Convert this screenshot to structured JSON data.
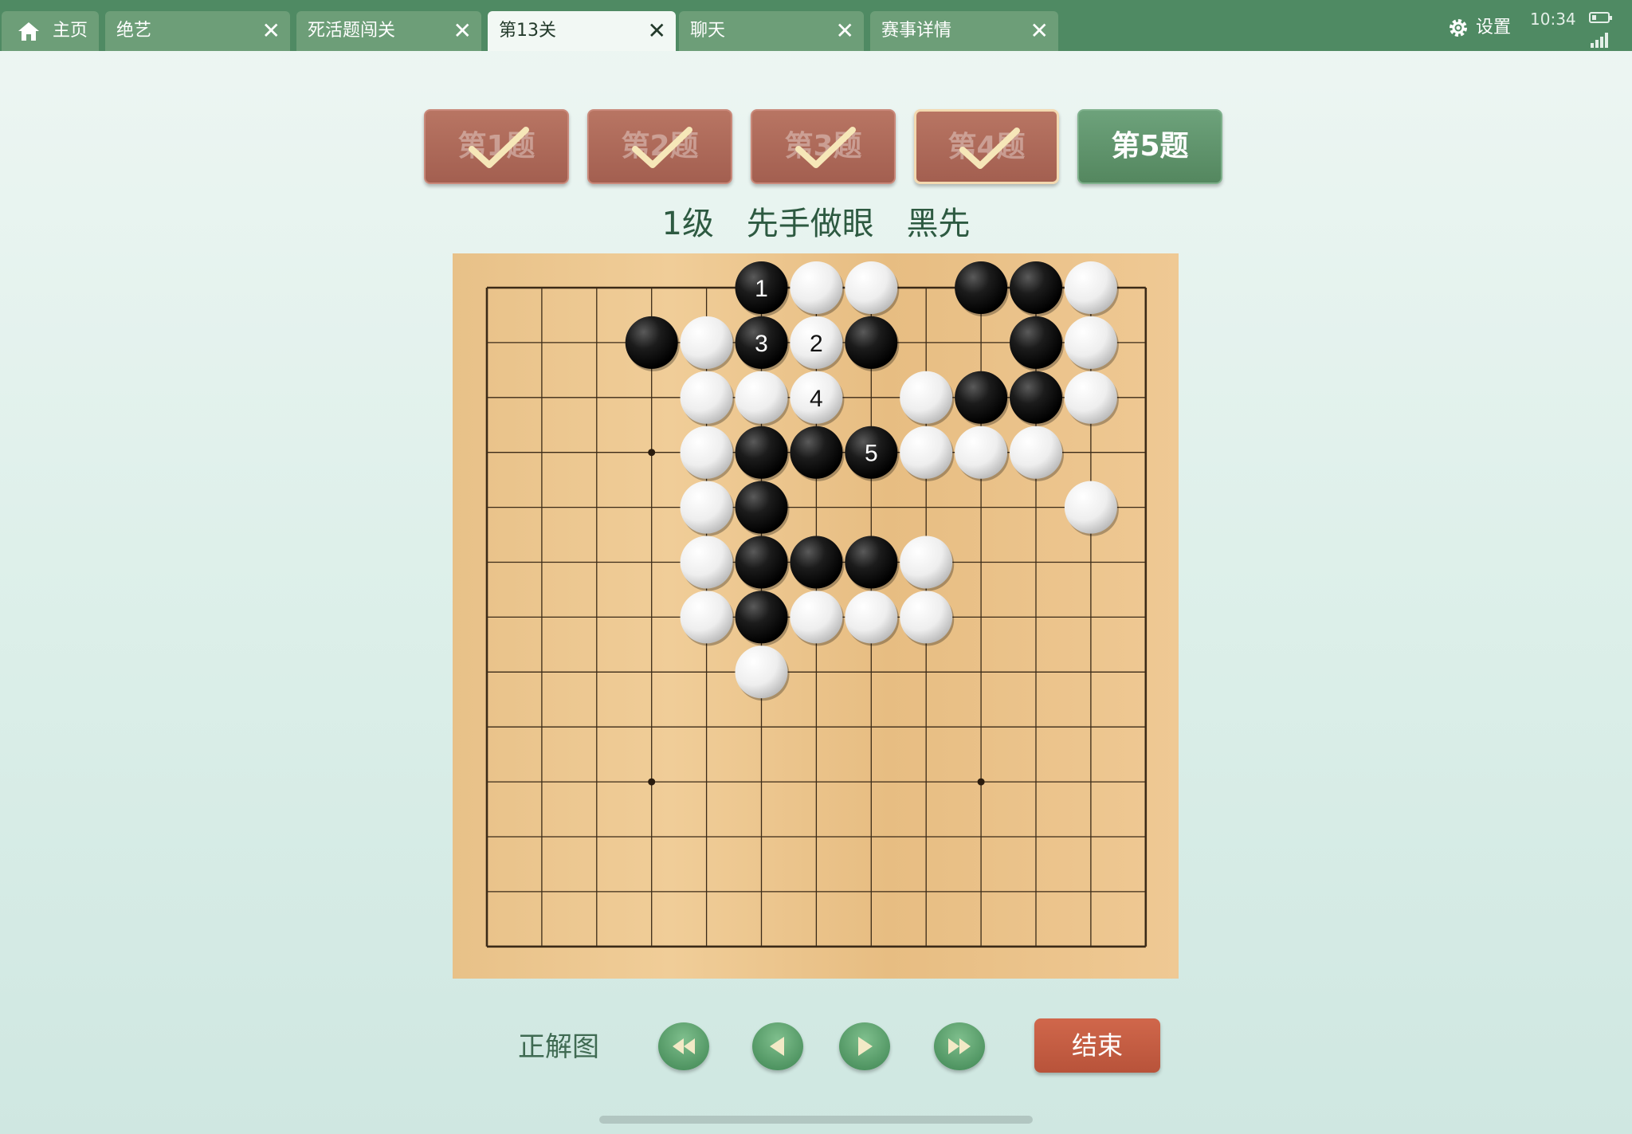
{
  "tabs": [
    {
      "label": "主页",
      "has_close": false,
      "icon": "home-icon"
    },
    {
      "label": "绝艺",
      "has_close": true
    },
    {
      "label": "死活题闯关",
      "has_close": true
    },
    {
      "label": "第13关",
      "has_close": true,
      "active": true
    },
    {
      "label": "聊天",
      "has_close": true
    },
    {
      "label": "赛事详情",
      "has_close": true
    }
  ],
  "tab_close_glyph": "✕",
  "status": {
    "settings_label": "设置",
    "time": "10:34",
    "battery_fraction": 0.25
  },
  "problems": [
    {
      "label": "第1题",
      "solved": true
    },
    {
      "label": "第2题",
      "solved": true
    },
    {
      "label": "第3题",
      "solved": true
    },
    {
      "label": "第4题",
      "solved": true,
      "selected": true
    },
    {
      "label": "第5题",
      "solved": false,
      "current": true
    }
  ],
  "problem_info": {
    "level": "1级",
    "theme": "先手做眼",
    "to_play": "黑先"
  },
  "board": {
    "size": 13,
    "star_points": [
      [
        3,
        3
      ],
      [
        3,
        9
      ],
      [
        9,
        3
      ],
      [
        9,
        9
      ]
    ],
    "black": [
      [
        5,
        0
      ],
      [
        3,
        1
      ],
      [
        6,
        1
      ],
      [
        7,
        1
      ],
      [
        9,
        0
      ],
      [
        10,
        0
      ],
      [
        10,
        1
      ],
      [
        6,
        2
      ],
      [
        9,
        2
      ],
      [
        10,
        2
      ],
      [
        6,
        3
      ],
      [
        5,
        3
      ],
      [
        7,
        3
      ],
      [
        5,
        4
      ],
      [
        5,
        5
      ],
      [
        6,
        5
      ],
      [
        7,
        5
      ],
      [
        5,
        6
      ]
    ],
    "white": [
      [
        4,
        1
      ],
      [
        4,
        2
      ],
      [
        4,
        3
      ],
      [
        4,
        4
      ],
      [
        4,
        5
      ],
      [
        4,
        6
      ],
      [
        5,
        3
      ],
      [
        5,
        7
      ],
      [
        6,
        0
      ],
      [
        7,
        0
      ],
      [
        11,
        0
      ],
      [
        11,
        1
      ],
      [
        11,
        2
      ],
      [
        11,
        4
      ],
      [
        8,
        2
      ],
      [
        8,
        3
      ],
      [
        9,
        3
      ],
      [
        10,
        3
      ],
      [
        8,
        5
      ],
      [
        6,
        6
      ],
      [
        7,
        6
      ],
      [
        8,
        6
      ],
      [
        5,
        2
      ],
      [
        8,
        6
      ]
    ],
    "moves": [
      {
        "n": "1",
        "color": "black",
        "pos": [
          5,
          0
        ]
      },
      {
        "n": "2",
        "color": "white",
        "pos": [
          6,
          1
        ]
      },
      {
        "n": "3",
        "color": "black",
        "pos": [
          5,
          1
        ]
      },
      {
        "n": "4",
        "color": "white",
        "pos": [
          6,
          2
        ]
      },
      {
        "n": "5",
        "color": "black",
        "pos": [
          7,
          3
        ]
      }
    ]
  },
  "controls": {
    "answer_label": "正解图",
    "end_label": "结束",
    "nav": [
      "first-move-icon",
      "prev-move-icon",
      "next-move-icon",
      "last-move-icon"
    ]
  },
  "colors": {
    "bar": "#4f8a63",
    "tab": "#6d9e78",
    "solved_btn": "#a35f50",
    "current_btn": "#54875f",
    "end_btn": "#b8533a"
  }
}
